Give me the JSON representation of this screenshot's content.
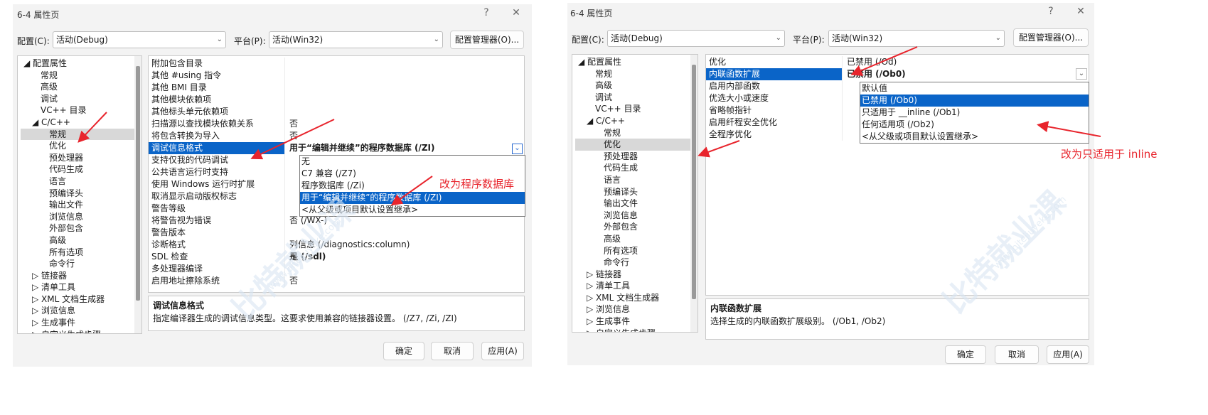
{
  "left": {
    "title": "6-4 属性页",
    "help_glyph": "?",
    "close_glyph": "✕",
    "config_label": "配置(C):",
    "config_value": "活动(Debug)",
    "platform_label": "平台(P):",
    "platform_value": "活动(Win32)",
    "config_manager": "配置管理器(O)...",
    "tree": [
      {
        "text": "◢ 配置属性",
        "indent": 0
      },
      {
        "text": "常规",
        "indent": 2
      },
      {
        "text": "高级",
        "indent": 2
      },
      {
        "text": "调试",
        "indent": 2
      },
      {
        "text": "VC++ 目录",
        "indent": 2
      },
      {
        "text": "◢ C/C++",
        "indent": 1
      },
      {
        "text": "常规",
        "indent": 3,
        "selected": true
      },
      {
        "text": "优化",
        "indent": 3
      },
      {
        "text": "预处理器",
        "indent": 3
      },
      {
        "text": "代码生成",
        "indent": 3
      },
      {
        "text": "语言",
        "indent": 3
      },
      {
        "text": "预编译头",
        "indent": 3
      },
      {
        "text": "输出文件",
        "indent": 3
      },
      {
        "text": "浏览信息",
        "indent": 3
      },
      {
        "text": "外部包含",
        "indent": 3
      },
      {
        "text": "高级",
        "indent": 3
      },
      {
        "text": "所有选项",
        "indent": 3
      },
      {
        "text": "命令行",
        "indent": 3
      },
      {
        "text": "▷ 链接器",
        "indent": 1
      },
      {
        "text": "▷ 清单工具",
        "indent": 1
      },
      {
        "text": "▷ XML 文档生成器",
        "indent": 1
      },
      {
        "text": "▷ 浏览信息",
        "indent": 1
      },
      {
        "text": "▷ 生成事件",
        "indent": 1
      },
      {
        "text": "▷ 自定义生成步骤",
        "indent": 1
      }
    ],
    "props": [
      {
        "name": "附加包含目录",
        "value": ""
      },
      {
        "name": "其他 #using 指令",
        "value": ""
      },
      {
        "name": "其他 BMI 目录",
        "value": ""
      },
      {
        "name": "其他模块依赖项",
        "value": ""
      },
      {
        "name": "其他标头单元依赖项",
        "value": ""
      },
      {
        "name": "扫描源以查找模块依赖关系",
        "value": "否"
      },
      {
        "name": "将包含转换为导入",
        "value": "否"
      },
      {
        "name": "调试信息格式",
        "value": "用于“编辑并继续”的程序数据库 (/ZI)",
        "highlight": true
      },
      {
        "name": "支持仅我的代码调试",
        "value": ""
      },
      {
        "name": "公共语言运行时支持",
        "value": ""
      },
      {
        "name": "使用 Windows 运行时扩展",
        "value": ""
      },
      {
        "name": "取消显示启动版权标志",
        "value": ""
      },
      {
        "name": "警告等级",
        "value": ""
      },
      {
        "name": "将警告视为错误",
        "value": "否 (/WX-)"
      },
      {
        "name": "警告版本",
        "value": ""
      },
      {
        "name": "诊断格式",
        "value": "列信息 (/diagnostics:column)"
      },
      {
        "name": "SDL 检查",
        "value": "是 (/sdl)",
        "bold": true
      },
      {
        "name": "多处理器编译",
        "value": ""
      },
      {
        "name": "启用地址擦除系统",
        "value": "否"
      }
    ],
    "dropdown": [
      {
        "text": "无"
      },
      {
        "text": "C7 兼容 (/Z7)"
      },
      {
        "text": "程序数据库 (/Zi)"
      },
      {
        "text": "用于“编辑并继续”的程序数据库 (/ZI)",
        "selected": true
      },
      {
        "text": "<从父级或项目默认设置继承>"
      }
    ],
    "desc_title": "调试信息格式",
    "desc_text": "指定编译器生成的调试信息类型。这要求使用兼容的链接器设置。 (/Z7, /Zi, /ZI)",
    "ok": "确定",
    "cancel": "取消",
    "apply": "应用(A)",
    "annotation": "改为程序数据库"
  },
  "right": {
    "title": "6-4 属性页",
    "help_glyph": "?",
    "close_glyph": "✕",
    "config_label": "配置(C):",
    "config_value": "活动(Debug)",
    "platform_label": "平台(P):",
    "platform_value": "活动(Win32)",
    "config_manager": "配置管理器(O)...",
    "tree": [
      {
        "text": "◢ 配置属性",
        "indent": 0
      },
      {
        "text": "常规",
        "indent": 2
      },
      {
        "text": "高级",
        "indent": 2
      },
      {
        "text": "调试",
        "indent": 2
      },
      {
        "text": "VC++ 目录",
        "indent": 2
      },
      {
        "text": "◢ C/C++",
        "indent": 1
      },
      {
        "text": "常规",
        "indent": 3
      },
      {
        "text": "优化",
        "indent": 3,
        "selected": true
      },
      {
        "text": "预处理器",
        "indent": 3
      },
      {
        "text": "代码生成",
        "indent": 3
      },
      {
        "text": "语言",
        "indent": 3
      },
      {
        "text": "预编译头",
        "indent": 3
      },
      {
        "text": "输出文件",
        "indent": 3
      },
      {
        "text": "浏览信息",
        "indent": 3
      },
      {
        "text": "外部包含",
        "indent": 3
      },
      {
        "text": "高级",
        "indent": 3
      },
      {
        "text": "所有选项",
        "indent": 3
      },
      {
        "text": "命令行",
        "indent": 3
      },
      {
        "text": "▷ 链接器",
        "indent": 1
      },
      {
        "text": "▷ 清单工具",
        "indent": 1
      },
      {
        "text": "▷ XML 文档生成器",
        "indent": 1
      },
      {
        "text": "▷ 浏览信息",
        "indent": 1
      },
      {
        "text": "▷ 生成事件",
        "indent": 1
      },
      {
        "text": "▷ 自定义生成步骤",
        "indent": 1
      }
    ],
    "props": [
      {
        "name": "优化",
        "value": "已禁用 (/Od)"
      },
      {
        "name": "内联函数扩展",
        "value": "已禁用 (/Ob0)",
        "highlight": true
      },
      {
        "name": "启用内部函数",
        "value": ""
      },
      {
        "name": "优选大小或速度",
        "value": ""
      },
      {
        "name": "省略帧指针",
        "value": ""
      },
      {
        "name": "启用纤程安全优化",
        "value": ""
      },
      {
        "name": "全程序优化",
        "value": ""
      }
    ],
    "dropdown": [
      {
        "text": "默认值"
      },
      {
        "text": "已禁用 (/Ob0)",
        "selected": true
      },
      {
        "text": "只适用于 __inline (/Ob1)"
      },
      {
        "text": "任何适用项 (/Ob2)"
      },
      {
        "text": "<从父级或项目默认设置继承>"
      }
    ],
    "desc_title": "内联函数扩展",
    "desc_text": "选择生成的内联函数扩展级别。 (/Ob1, /Ob2)",
    "ok": "确定",
    "cancel": "取消",
    "apply": "应用(A)",
    "annotation": "改为只适用于 inline"
  },
  "watermark": {
    "brand": "比特就业课",
    "site": "www.bitejiuyeke.com"
  },
  "colors": {
    "selection": "#0a64c8",
    "annotation": "#e8242c"
  }
}
